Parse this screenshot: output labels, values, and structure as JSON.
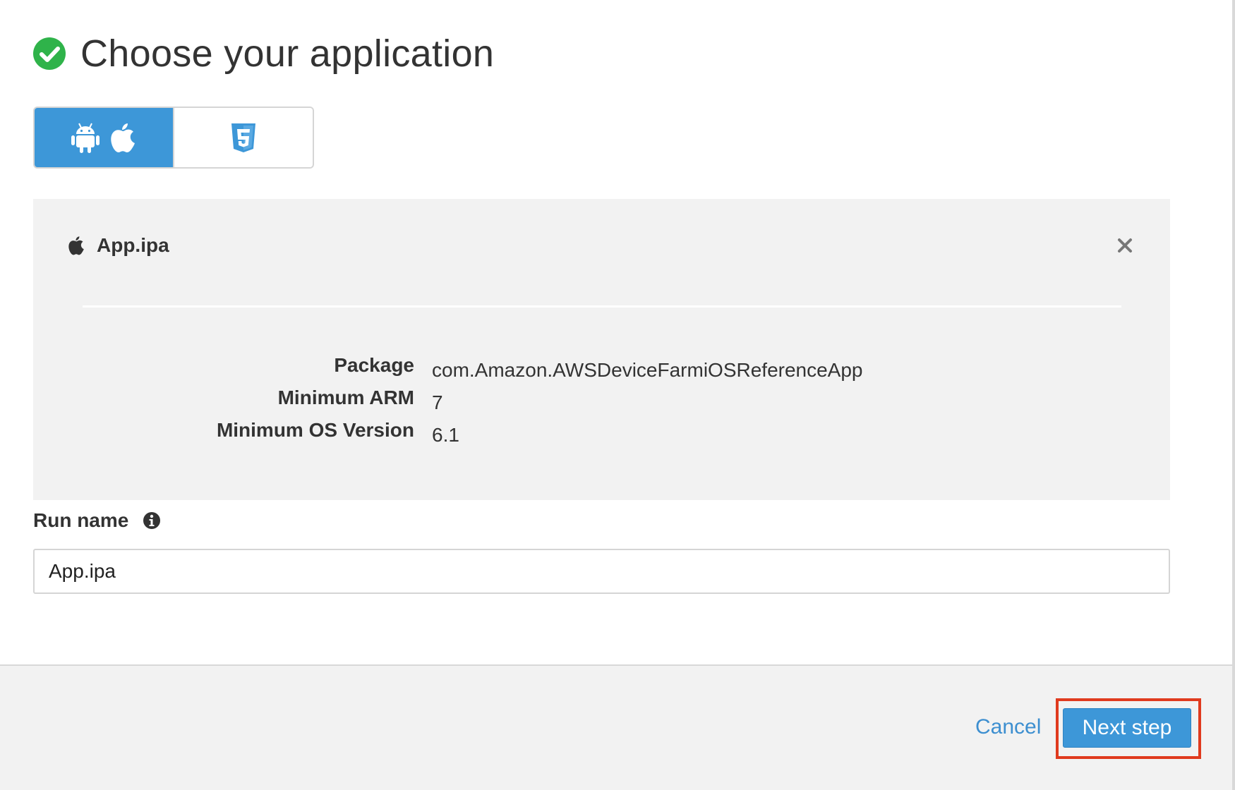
{
  "header": {
    "title": "Choose your application"
  },
  "app_type_toggle": {
    "options": [
      {
        "icons": [
          "android-icon",
          "apple-icon"
        ],
        "selected": true
      },
      {
        "icons": [
          "html5-icon"
        ],
        "selected": false
      }
    ]
  },
  "file": {
    "name": "App.ipa",
    "icon": "apple-icon",
    "details": [
      {
        "key": "Package",
        "value": "com.Amazon.AWSDeviceFarmiOSReferenceApp"
      },
      {
        "key": "Minimum ARM",
        "value": "7"
      },
      {
        "key": "Minimum OS Version",
        "value": "6.1"
      }
    ]
  },
  "run_name": {
    "label": "Run name",
    "value": "App.ipa"
  },
  "footer": {
    "cancel_label": "Cancel",
    "next_label": "Next step"
  },
  "colors": {
    "accent": "#3d97d8",
    "success": "#2fb34a",
    "highlight": "#e03a1e",
    "panel": "#f2f2f2"
  }
}
